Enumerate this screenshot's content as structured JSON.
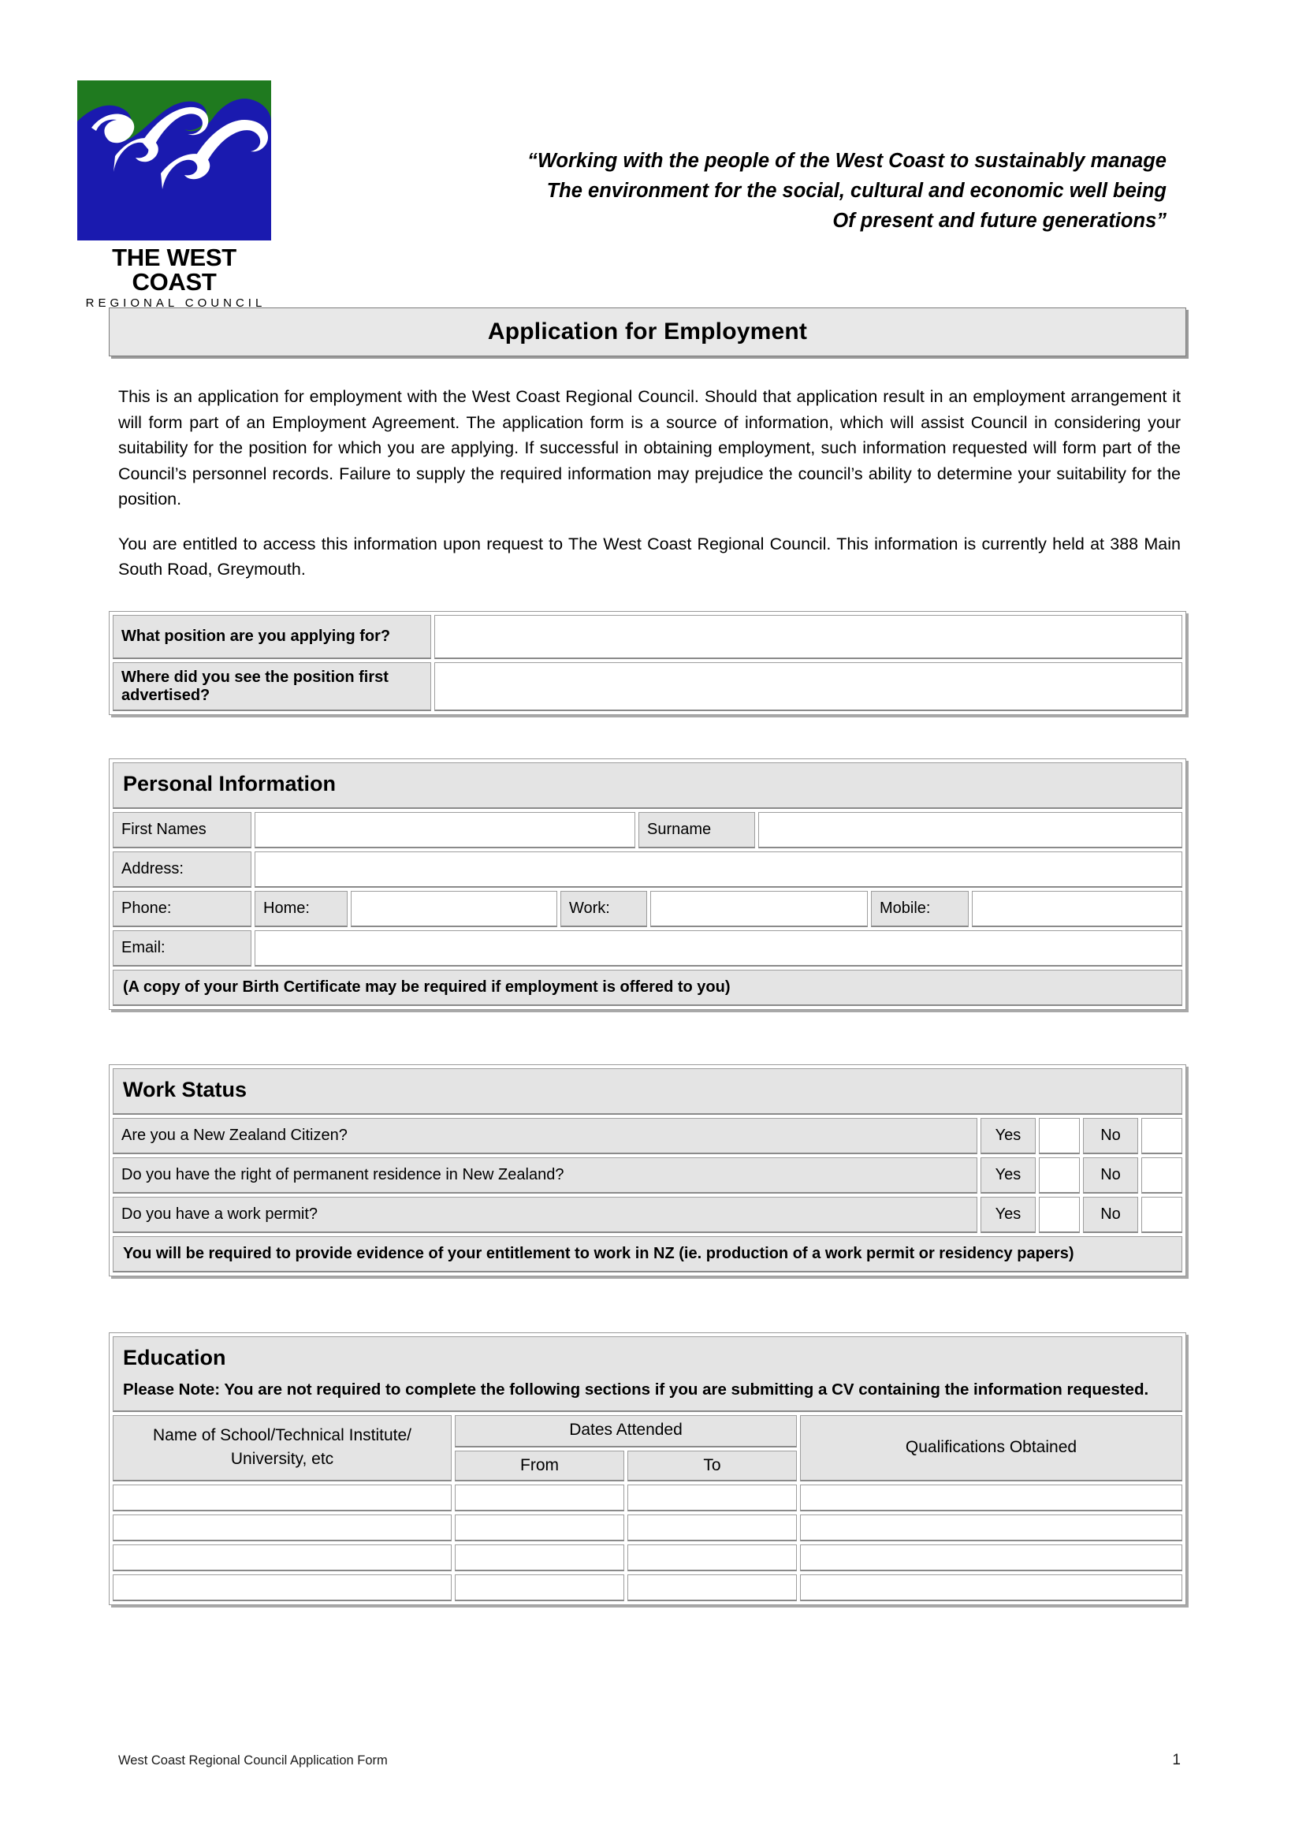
{
  "document": {
    "title": "Application for Employment",
    "organisation": "West Coast Regional Council"
  },
  "header": {
    "logo": {
      "icon_name": "west-coast-wave-logo",
      "word_line1": "THE WEST COAST",
      "word_line2": "REGIONAL COUNCIL",
      "green": "#1F7A1F",
      "blue": "#1A1AAF",
      "white": "#FFFFFF"
    },
    "tagline_line1": "“Working with the people of the West Coast to sustainably manage",
    "tagline_line2": "The environment for the social, cultural and economic well being",
    "tagline_line3": "Of present and future generations”"
  },
  "intro": {
    "paragraph1": "This is an application for employment with the West Coast Regional Council.  Should that application result in an employment arrangement it will form part of an Employment Agreement.  The application form is a source of information, which will assist Council in considering your suitability for the position for which you are applying.  If successful in obtaining employment, such information requested will form part of the Council’s personnel records.  Failure to supply the required information may prejudice the council’s ability to determine your suitability for the position.",
    "paragraph2": "You are entitled to access this information upon request to The West Coast Regional Council.  This information is currently held at 388 Main South Road, Greymouth."
  },
  "position_block": {
    "rows": [
      {
        "label": "What position are you applying for?",
        "value": ""
      },
      {
        "label": "Where did you see the position first advertised?",
        "value": ""
      }
    ]
  },
  "personal_information": {
    "heading": "Personal Information",
    "first_names_label": "First Names",
    "first_names_value": "",
    "surname_label": "Surname",
    "surname_value": "",
    "address_label": "Address:",
    "address_value": "",
    "phone_label": "Phone:",
    "home_label": "Home:",
    "home_value": "",
    "work_label": "Work:",
    "work_value": "",
    "mobile_label": "Mobile:",
    "mobile_value": "",
    "email_label": "Email:",
    "email_value": "",
    "note": "(A copy of your Birth Certificate may be required if employment is offered to you)"
  },
  "work_status": {
    "heading": "Work Status",
    "yes_label": "Yes",
    "no_label": "No",
    "questions": [
      "Are you a New Zealand Citizen?",
      "Do you have the right of permanent residence in New Zealand?",
      "Do you have a work permit?"
    ],
    "note": "You will be required to provide evidence of your entitlement to work in NZ (ie. production of a work permit or residency papers)"
  },
  "education": {
    "heading": "Education",
    "note": "Please Note: You are not required to complete the following sections if you are submitting a CV containing the information requested.",
    "columns": {
      "school": "Name of School/Technical Institute/ University, etc",
      "dates_attended": "Dates Attended",
      "from": "From",
      "to": "To",
      "qualifications": "Qualifications Obtained"
    },
    "rows": [
      {
        "school": "",
        "from": "",
        "to": "",
        "qualifications": ""
      },
      {
        "school": "",
        "from": "",
        "to": "",
        "qualifications": ""
      },
      {
        "school": "",
        "from": "",
        "to": "",
        "qualifications": ""
      },
      {
        "school": "",
        "from": "",
        "to": "",
        "qualifications": ""
      }
    ]
  },
  "footer": {
    "left_text": "West Coast Regional Council Application Form",
    "page_number": "1"
  }
}
